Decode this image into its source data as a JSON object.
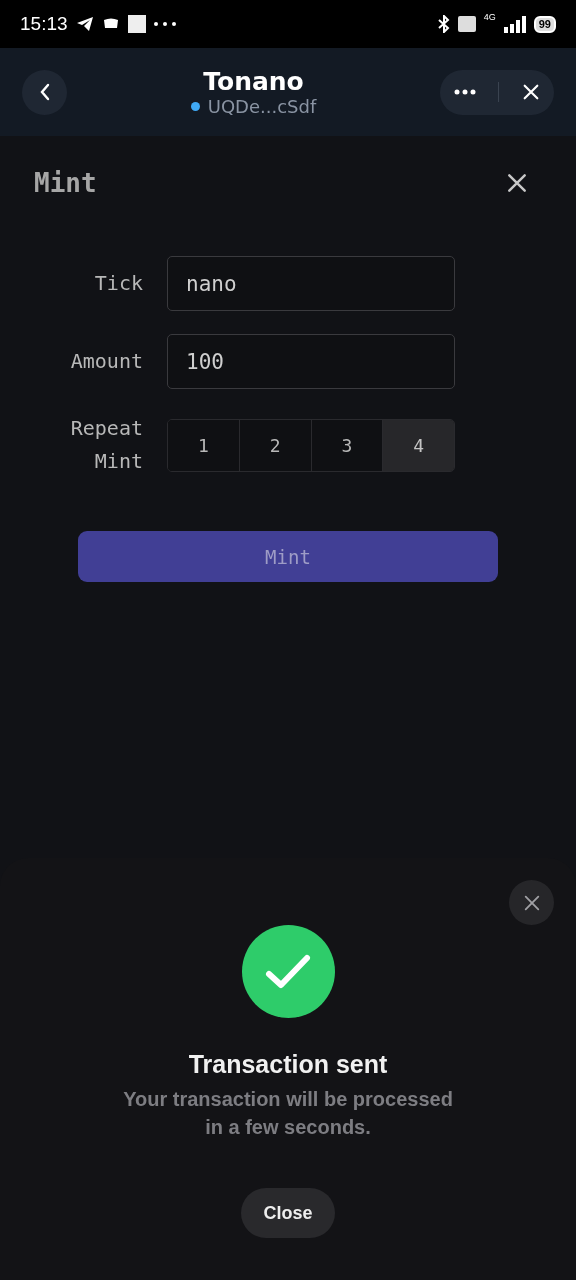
{
  "status_bar": {
    "time": "15:13",
    "network": "4G",
    "battery": "99"
  },
  "header": {
    "title": "Tonano",
    "wallet": "UQDe...cSdf",
    "connected": true
  },
  "mint_form": {
    "title": "Mint",
    "fields": [
      {
        "label": "Tick",
        "value": "nano"
      },
      {
        "label": "Amount",
        "value": "100"
      }
    ],
    "repeat": {
      "label": "Repeat Mint",
      "options": [
        {
          "label": "1",
          "selected": false
        },
        {
          "label": "2",
          "selected": false
        },
        {
          "label": "3",
          "selected": false
        },
        {
          "label": "4",
          "selected": true
        }
      ]
    },
    "submit": "Mint"
  },
  "sheet": {
    "title": "Transaction sent",
    "message": "Your transaction will be processed in a few seconds.",
    "button": "Close"
  }
}
